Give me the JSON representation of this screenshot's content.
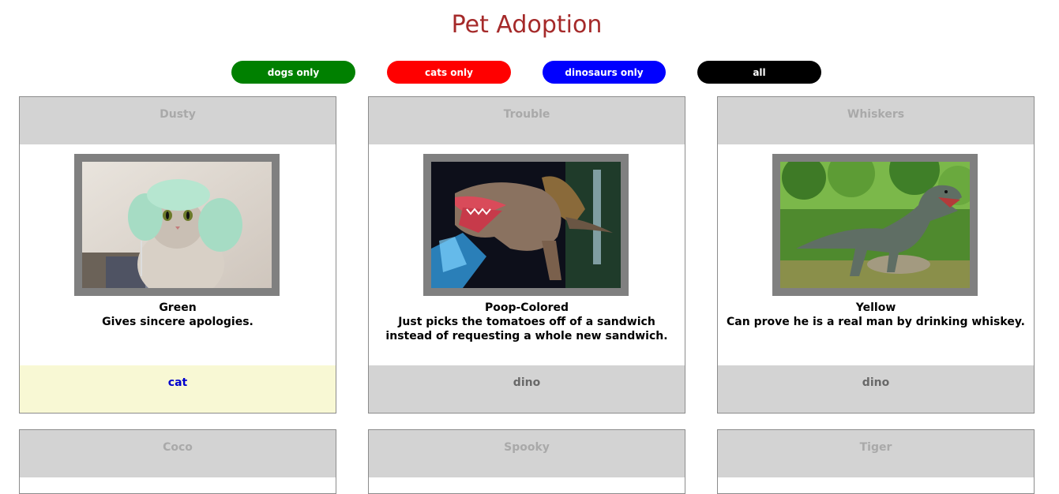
{
  "page": {
    "title": "Pet Adoption"
  },
  "filters": {
    "dogs": {
      "label": "dogs only",
      "color": "#008000"
    },
    "cats": {
      "label": "cats only",
      "color": "#ff0000"
    },
    "dinos": {
      "label": "dinosaurs only",
      "color": "#0000ff"
    },
    "all": {
      "label": "all",
      "color": "#000000"
    }
  },
  "pets": [
    {
      "name": "Dusty",
      "color": "Green",
      "description": "Gives sincere apologies.",
      "type": "cat",
      "photo": "cat-with-towel-hair"
    },
    {
      "name": "Trouble",
      "color": "Poop-Colored",
      "description": "Just picks the tomatoes off of a sandwich instead of requesting a whole new sandwich.",
      "type": "dino",
      "photo": "spinosaurus-model"
    },
    {
      "name": "Whiskers",
      "color": "Yellow",
      "description": "Can prove he is a real man by drinking whiskey.",
      "type": "dino",
      "photo": "t-rex-statue-in-forest"
    },
    {
      "name": "Coco"
    },
    {
      "name": "Spooky"
    },
    {
      "name": "Tiger"
    }
  ]
}
